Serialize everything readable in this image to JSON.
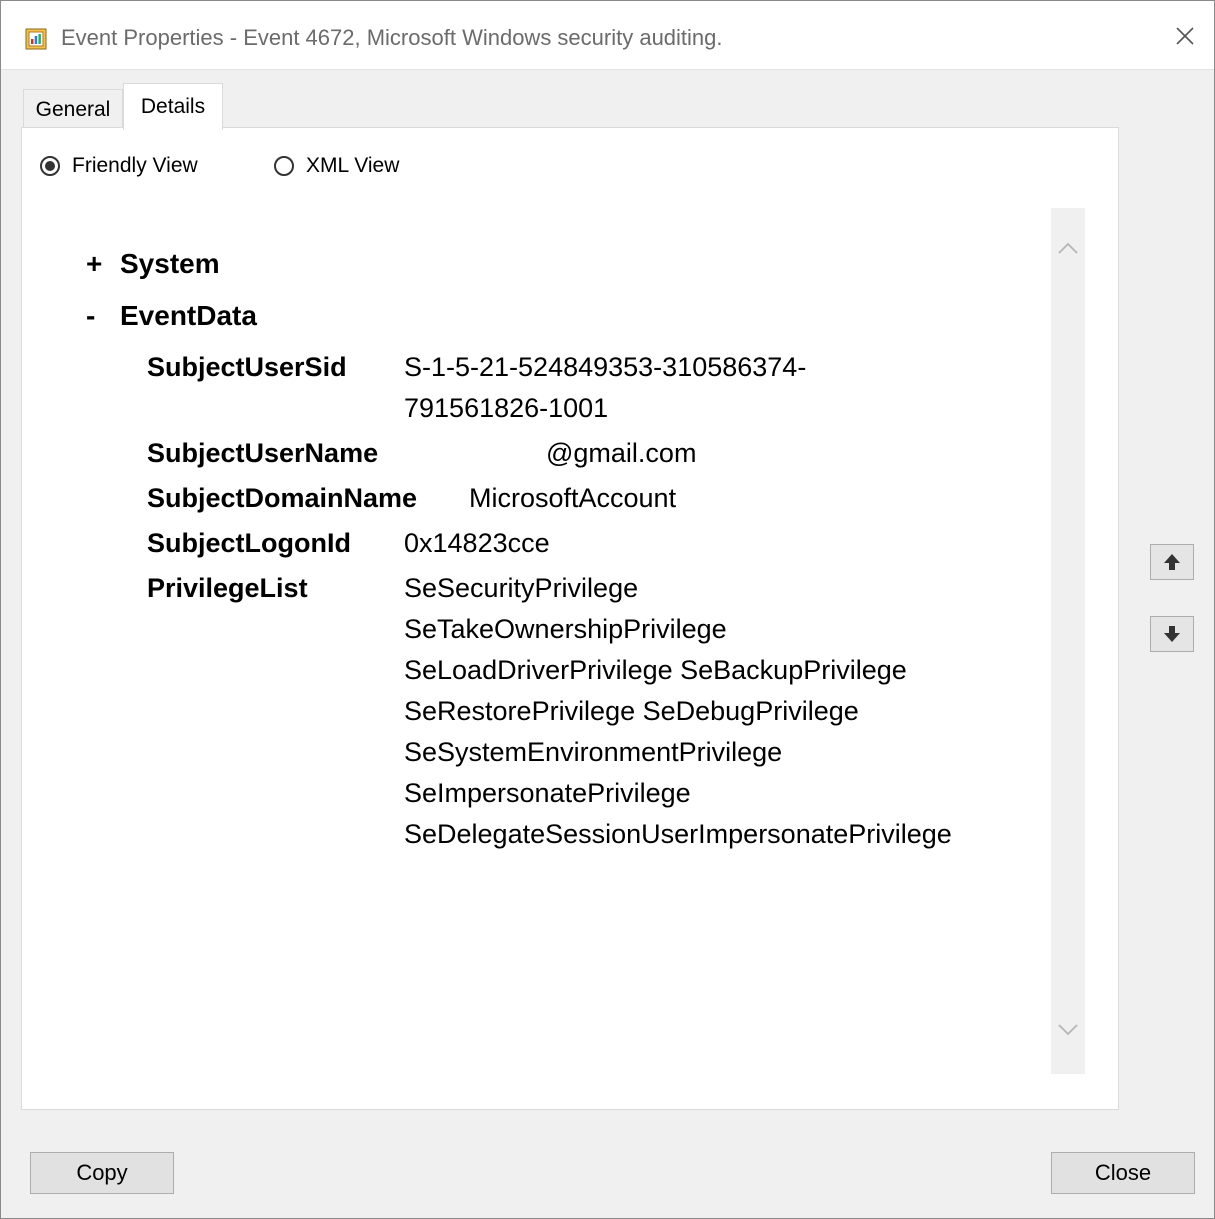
{
  "window": {
    "title": "Event Properties - Event 4672, Microsoft Windows security auditing.",
    "icon": "event-viewer-icon",
    "close_icon": "close-icon"
  },
  "tabs": [
    {
      "label": "General",
      "selected": false
    },
    {
      "label": "Details",
      "selected": true
    }
  ],
  "view_options": [
    {
      "label": "Friendly View",
      "selected": true
    },
    {
      "label": "XML View",
      "selected": false
    }
  ],
  "tree": {
    "system": {
      "toggle": "+",
      "label": "System"
    },
    "event_data": {
      "toggle": "-",
      "label": "EventData"
    }
  },
  "fields": {
    "subject_user_sid": {
      "name": "SubjectUserSid",
      "value_lines": [
        "S-1-5-21-524849353-310586374-",
        "791561826-1001"
      ]
    },
    "subject_user_name": {
      "name": "SubjectUserName",
      "value": "@gmail.com"
    },
    "subject_domain_name": {
      "name": "SubjectDomainName",
      "value": "MicrosoftAccount"
    },
    "subject_logon_id": {
      "name": "SubjectLogonId",
      "value": "0x14823cce"
    },
    "privilege_list": {
      "name": "PrivilegeList",
      "value_lines": [
        "SeSecurityPrivilege",
        "SeTakeOwnershipPrivilege",
        "SeLoadDriverPrivilege SeBackupPrivilege",
        "SeRestorePrivilege SeDebugPrivilege",
        "SeSystemEnvironmentPrivilege",
        "SeImpersonatePrivilege",
        "SeDelegateSessionUserImpersonatePrivilege"
      ]
    }
  },
  "scroll": {
    "up_icon": "chevron-up-icon",
    "down_icon": "chevron-down-icon"
  },
  "navigation": {
    "previous_icon": "arrow-up-icon",
    "next_icon": "arrow-down-icon"
  },
  "buttons": {
    "copy": "Copy",
    "close": "Close"
  }
}
